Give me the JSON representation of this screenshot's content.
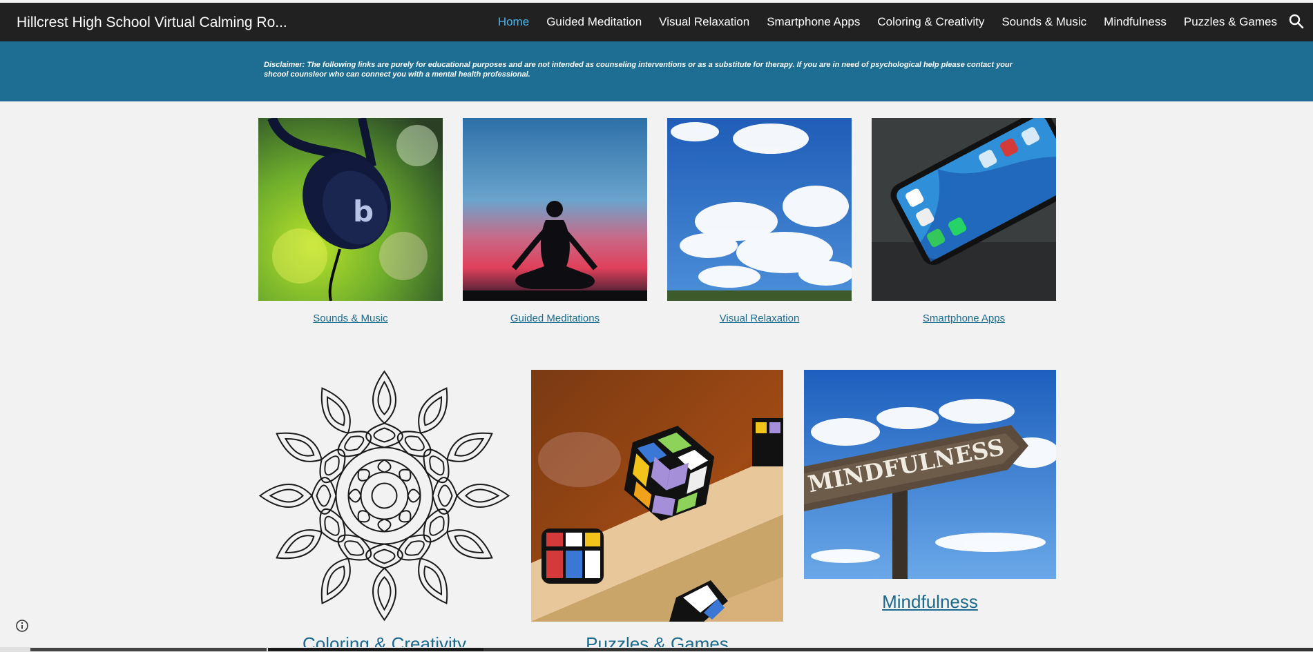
{
  "header": {
    "site_title": "Hillcrest High School Virtual Calming Ro...",
    "nav": [
      {
        "label": "Home",
        "active": true
      },
      {
        "label": "Guided Meditation"
      },
      {
        "label": "Visual Relaxation"
      },
      {
        "label": "Smartphone Apps"
      },
      {
        "label": "Coloring & Creativity"
      },
      {
        "label": "Sounds & Music"
      },
      {
        "label": "Mindfulness"
      },
      {
        "label": "Puzzles & Games"
      }
    ],
    "search_icon": "search-icon"
  },
  "banner": {
    "disclaimer": "Disclaimer: The following links are purely for educational purposes and are not intended as counseling interventions or as a substitute for therapy. If you are in need of psychological help please contact your shcool counsleor who can connect you with a mental health professional."
  },
  "gallery": {
    "row1": [
      {
        "caption": "Sounds & Music"
      },
      {
        "caption": "Guided Meditations"
      },
      {
        "caption": "Visual Relaxation"
      },
      {
        "caption": "Smartphone Apps"
      }
    ],
    "row2": [
      {
        "caption": "Coloring & Creativity"
      },
      {
        "caption": "Puzzles & Games"
      },
      {
        "caption": "Mindfulness",
        "sign_text": "MINDFULNESS"
      }
    ]
  },
  "colors": {
    "header_bg": "#212121",
    "banner_bg": "#1d6e92",
    "link": "#1b6a8c",
    "active_nav": "#4fb3e8"
  }
}
